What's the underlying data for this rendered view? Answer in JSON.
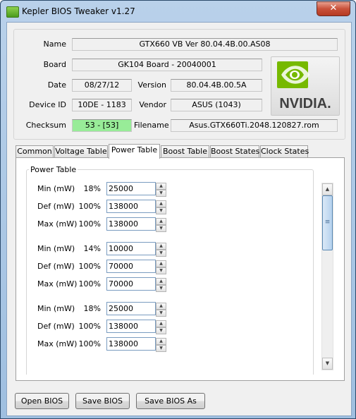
{
  "window": {
    "title": "Kepler BIOS Tweaker v1.27",
    "close_label": "✕"
  },
  "info": {
    "name_label": "Name",
    "name_value": "GTX660 VB Ver 80.04.4B.00.AS08",
    "board_label": "Board",
    "board_value": "GK104 Board - 20040001",
    "date_label": "Date",
    "date_value": "08/27/12",
    "version_label": "Version",
    "version_value": "80.04.4B.00.5A",
    "device_label": "Device ID",
    "device_value": "10DE - 1183",
    "vendor_label": "Vendor",
    "vendor_value": "ASUS (1043)",
    "checksum_label": "Checksum",
    "checksum_value": "53 - [53]",
    "checksum_color": "#98ec98",
    "filename_label": "Filename",
    "filename_value": "Asus.GTX660Ti.2048.120827.rom"
  },
  "logo": {
    "text": "NVIDIA.",
    "brand_color": "#76b900"
  },
  "tabs": [
    {
      "label": "Common"
    },
    {
      "label": "Voltage Table"
    },
    {
      "label": "Power Table"
    },
    {
      "label": "Boost Table"
    },
    {
      "label": "Boost States"
    },
    {
      "label": "Clock States"
    }
  ],
  "active_tab": "Power Table",
  "power_table": {
    "title": "Power Table",
    "rows": [
      {
        "label": "Min (mW)",
        "pct": "18%",
        "value": "25000"
      },
      {
        "label": "Def (mW)",
        "pct": "100%",
        "value": "138000"
      },
      {
        "label": "Max (mW)",
        "pct": "100%",
        "value": "138000"
      },
      {
        "label": "Min (mW)",
        "pct": "14%",
        "value": "10000"
      },
      {
        "label": "Def (mW)",
        "pct": "100%",
        "value": "70000"
      },
      {
        "label": "Max (mW)",
        "pct": "100%",
        "value": "70000"
      },
      {
        "label": "Min (mW)",
        "pct": "18%",
        "value": "25000"
      },
      {
        "label": "Def (mW)",
        "pct": "100%",
        "value": "138000"
      },
      {
        "label": "Max (mW)",
        "pct": "100%",
        "value": "138000"
      }
    ]
  },
  "buttons": {
    "open": "Open BIOS",
    "save": "Save BIOS",
    "save_as": "Save BIOS As"
  }
}
